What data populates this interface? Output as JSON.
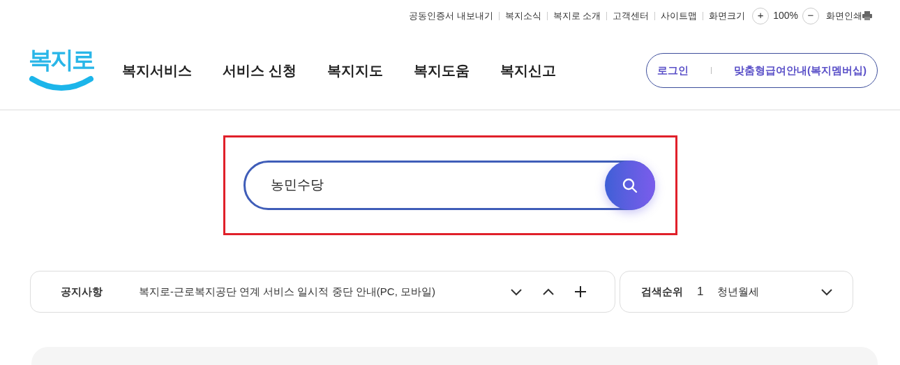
{
  "utility_links": [
    "공동인증서 내보내기",
    "복지소식",
    "복지로 소개",
    "고객센터",
    "사이트맵"
  ],
  "zoom": {
    "label": "화면크기",
    "plus": "+",
    "value": "100%",
    "minus": "−"
  },
  "print": {
    "label": "화면인쇄"
  },
  "logo": {
    "text": "복지로"
  },
  "nav": [
    "복지서비스",
    "서비스 신청",
    "복지지도",
    "복지도움",
    "복지신고"
  ],
  "account": {
    "login": "로그인",
    "membership": "맞춤형급여안내(복지멤버십)"
  },
  "search": {
    "value": "농민수당",
    "highlighted": true
  },
  "notice": {
    "label": "공지사항",
    "text": "복지로-근로복지공단 연계 서비스 일시적 중단 안내(PC, 모바일)"
  },
  "ranking": {
    "label": "검색순위",
    "rank": "1",
    "term": "청년월세"
  }
}
